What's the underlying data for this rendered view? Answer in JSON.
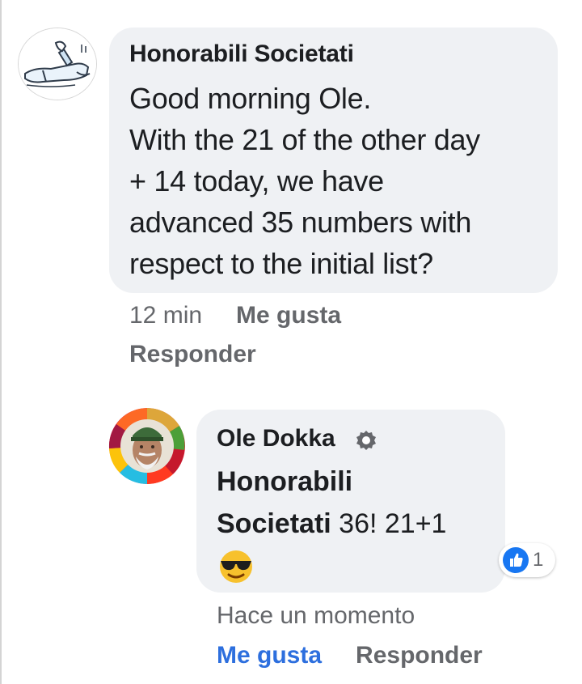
{
  "comments": [
    {
      "author": "Honorabili Societati",
      "lines": [
        "Good morning Ole.",
        "With the 21 of the other day",
        "+ 14 today, we have",
        "advanced 35 numbers with",
        "respect to the initial list?"
      ],
      "time": "12 min",
      "like_label": "Me gusta",
      "reply_label": "Responder",
      "avatar_icon": "drawing-avatar-icon"
    },
    {
      "author": "Ole Dokka",
      "verified_icon": "verified-badge-icon",
      "mention_line1": "Honorabili",
      "mention_line2": "Societati",
      "text": "36! 21+1",
      "emoji": "sunglasses-emoji-icon",
      "reaction_count": "1",
      "reaction_icon": "like-reaction-icon",
      "time": "Hace un momento",
      "like_label": "Me gusta",
      "reply_label": "Responder",
      "avatar_icon": "profile-photo-avatar"
    }
  ],
  "colors": {
    "bubble": "#eff1f4",
    "meta_text": "#65676b",
    "liked_blue": "#2d6fde",
    "reaction_blue": "#1877f2"
  }
}
